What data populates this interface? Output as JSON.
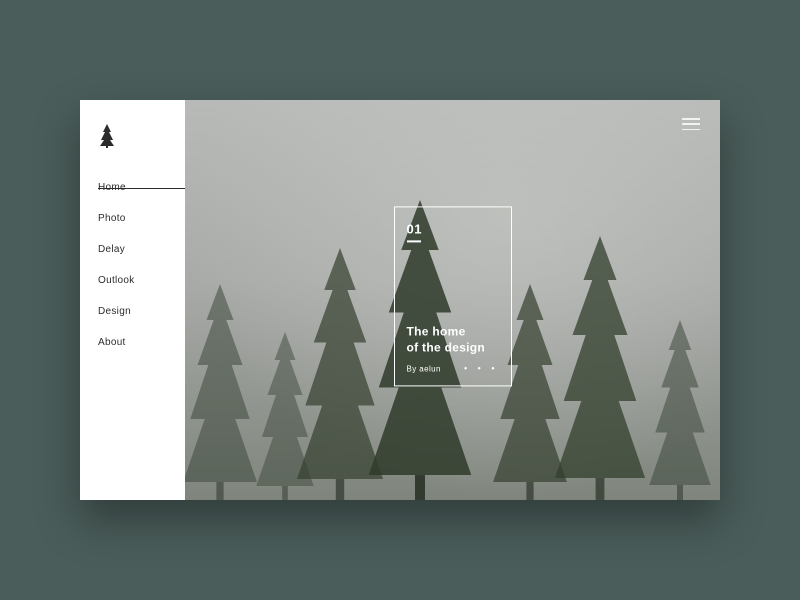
{
  "sidebar": {
    "items": [
      {
        "label": "Home",
        "active": true
      },
      {
        "label": "Photo",
        "active": false
      },
      {
        "label": "Delay",
        "active": false
      },
      {
        "label": "Outlook",
        "active": false
      },
      {
        "label": "Design",
        "active": false
      },
      {
        "label": "About",
        "active": false
      }
    ]
  },
  "hero": {
    "frame": {
      "number": "01",
      "title_line1": "The home",
      "title_line2": "of the design",
      "byline": "By aelun",
      "dots": "• • •"
    }
  },
  "colors": {
    "page_bg": "#4a5d5a",
    "frame_border": "#ffffff",
    "text_dark": "#2c2c2c"
  }
}
